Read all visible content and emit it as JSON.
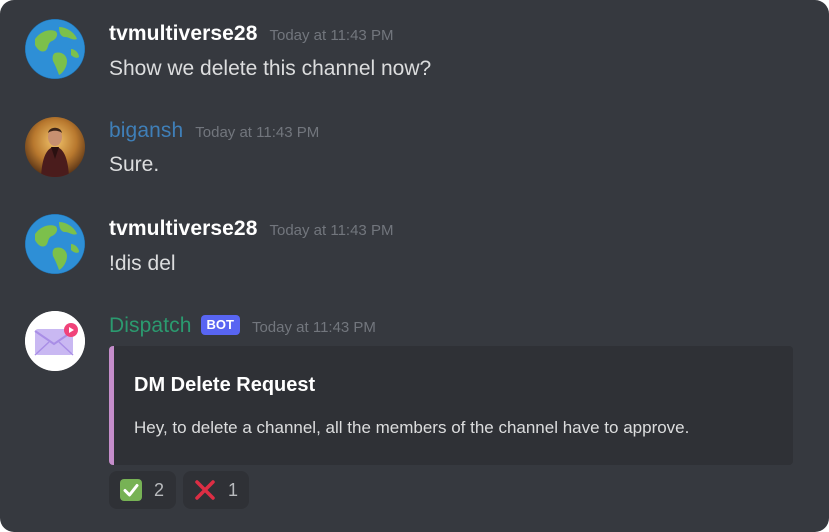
{
  "messages": [
    {
      "author": "tvmultiverse28",
      "timestamp": "Today at 11:43 PM",
      "text": "Show we delete this channel now?",
      "avatar": "earth-globe-icon"
    },
    {
      "author": "bigansh",
      "timestamp": "Today at 11:43 PM",
      "text": "Sure.",
      "avatar": "person-photo",
      "name_color": "#3f7fb8"
    },
    {
      "author": "tvmultiverse28",
      "timestamp": "Today at 11:43 PM",
      "text": "!dis del",
      "avatar": "earth-globe-icon"
    },
    {
      "author": "Dispatch",
      "badge": "BOT",
      "timestamp": "Today at 11:43 PM",
      "avatar": "envelope-icon",
      "name_color": "#2b9a6f",
      "embed": {
        "title": "DM Delete Request",
        "description": "Hey, to delete a channel, all the members of the channel have to approve.",
        "accent_color": "#c58dcb"
      },
      "reactions": [
        {
          "emoji": "check-mark-icon",
          "count": "2"
        },
        {
          "emoji": "cross-mark-icon",
          "count": "1"
        }
      ]
    }
  ],
  "colors": {
    "background": "#36393f",
    "embed_background": "#2f3136",
    "bot_badge": "#5865f2"
  }
}
